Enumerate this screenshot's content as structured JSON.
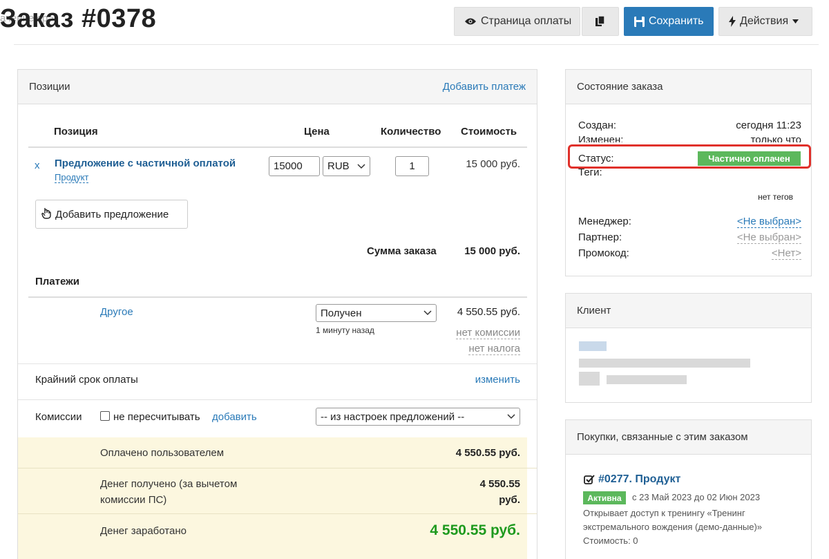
{
  "header": {
    "ghost_text": "ачение cp>",
    "title": "Заказ #0378",
    "btn_payment_page": "Страница оплаты",
    "btn_save": "Сохранить",
    "btn_actions": "Действия"
  },
  "positions": {
    "panel_title": "Позиции",
    "add_payment_link": "Добавить платеж",
    "col_position": "Позиция",
    "col_price": "Цена",
    "col_quantity": "Количество",
    "col_cost": "Стоимость",
    "items": [
      {
        "remove": "x",
        "name": "Предложение с частичной оплатой",
        "type": "Продукт",
        "price": "15000",
        "currency": "RUB",
        "quantity": "1",
        "cost": "15 000 руб."
      }
    ],
    "add_offer_button": "Добавить предложение",
    "order_sum_label": "Сумма заказа",
    "order_sum_value": "15 000 руб."
  },
  "payments": {
    "title": "Платежи",
    "items": [
      {
        "name": "Другое",
        "status": "Получен",
        "time": "1 минуту назад",
        "amount": "4 550.55 руб.",
        "commission": "нет комиссии",
        "tax": "нет налога"
      }
    ],
    "deadline_label": "Крайний срок оплаты",
    "deadline_action": "изменить",
    "commissions_label": "Комиссии",
    "no_recalc_label": "не пересчитывать",
    "add_link": "добавить",
    "commission_source": "-- из настроек предложений --"
  },
  "summary": {
    "paid_label": "Оплачено пользователем",
    "paid_value": "4 550.55 руб.",
    "received_label_1": "Денег получено (за вычетом",
    "received_label_2": "комиссии ПС)",
    "received_value_1": "4 550.55",
    "received_value_2": "руб.",
    "earned_label": "Денег заработано",
    "earned_value": "4 550.55 руб."
  },
  "order_state": {
    "title": "Состояние заказа",
    "created_label": "Создан:",
    "created_value": "сегодня 11:23",
    "modified_label": "Изменен:",
    "modified_value": "только что",
    "status_label": "Статус:",
    "status_value": "Частично оплачен",
    "tags_label": "Теги:",
    "tags_value": "нет тегов",
    "manager_label": "Менеджер:",
    "manager_value": "<Не выбран>",
    "partner_label": "Партнер:",
    "partner_value": "<Не выбран>",
    "promo_label": "Промокод:",
    "promo_value": "<Нет>"
  },
  "client": {
    "title": "Клиент"
  },
  "related": {
    "title": "Покупки, связанные с этим заказом",
    "items": [
      {
        "title": "#0277. Продукт",
        "badge": "Активна",
        "period": "с 23 Май 2023 до 02 Июн 2023",
        "desc_1": "Открывает доступ к тренингу «Тренинг",
        "desc_2": "экстремального вождения (демо-данные)»",
        "cost": "Стоимость: 0"
      }
    ]
  },
  "colors": {
    "accent": "#2a7ab8",
    "status_green": "#5cb85c",
    "earned_green": "#1e9a1e",
    "highlight_red": "#e0302a",
    "summary_bg": "#fcf7df"
  }
}
